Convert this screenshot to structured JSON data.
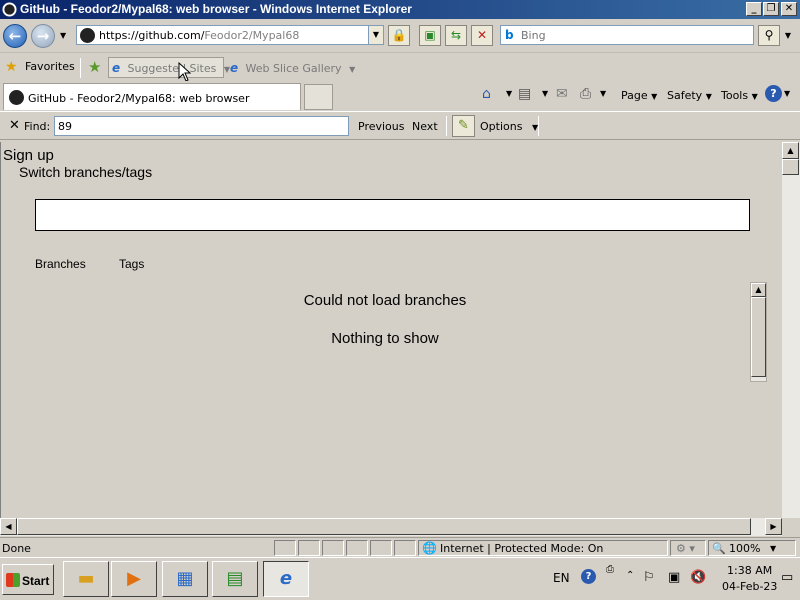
{
  "window": {
    "title": "GitHub - Feodor2/Mypal68: web browser - Windows Internet Explorer",
    "minimize_glyph": "_",
    "maximize_glyph": "❐",
    "close_glyph": "✕"
  },
  "address_bar": {
    "url_host": "https://github.com/",
    "url_path": "Feodor2/Mypal68",
    "search_placeholder": "Bing"
  },
  "favorites_bar": {
    "favorites_label": "Favorites",
    "items": [
      "Suggested Sites",
      "Web Slice Gallery"
    ]
  },
  "tabs": [
    {
      "title": "GitHub - Feodor2/Mypal68: web browser"
    }
  ],
  "command_bar": {
    "page_label": "Page",
    "safety_label": "Safety",
    "tools_label": "Tools"
  },
  "find_bar": {
    "label": "Find:",
    "query": "89",
    "previous_label": "Previous",
    "next_label": "Next",
    "options_label": "Options"
  },
  "page": {
    "signup_link": "Sign up",
    "switch_title": "Switch branches/tags",
    "filter_value": "",
    "subtabs": [
      "Branches",
      "Tags"
    ],
    "error_message": "Could not load branches",
    "empty_message": "Nothing to show"
  },
  "status_bar": {
    "status_text": "Done",
    "zone_text": "Internet | Protected Mode: On",
    "zoom_text": "100%"
  },
  "taskbar": {
    "start_label": "Start",
    "language": "EN",
    "time": "1:38 AM",
    "date": "04-Feb-23"
  },
  "icons": {
    "back": "back-arrow-icon",
    "forward": "forward-arrow-icon",
    "lock": "lock-icon",
    "refresh": "refresh-icon",
    "stop": "stop-icon",
    "search": "search-icon",
    "home": "home-icon",
    "feeds": "feeds-icon",
    "mail": "mail-icon",
    "print": "print-icon",
    "help": "help-icon"
  },
  "colors": {
    "titlebar_start": "#0a246a",
    "titlebar_end": "#3a6ea5",
    "chrome": "#d4d0c8"
  }
}
